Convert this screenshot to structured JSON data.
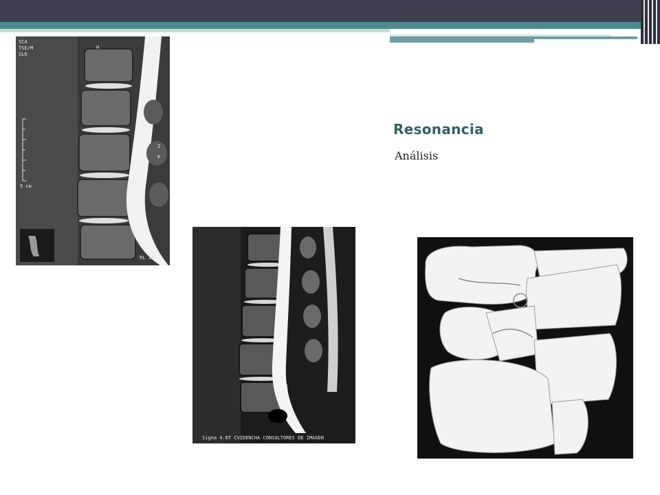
{
  "slide": {
    "title": "Resonancia",
    "subtitle": "Análisis"
  },
  "images": {
    "mri_sagittal_1": {
      "labels": [
        "SC4",
        "TSE/M",
        "SL6",
        "H",
        "I",
        "P",
        "5 cm",
        "RL 14"
      ]
    },
    "mri_sagittal_2": {
      "footer_text": "Signa 4.6T CVIDENCHA CONSULTORES DE IMAGEN"
    },
    "spine_3d_render": {}
  },
  "colors": {
    "header_dark": "#3f3f4f",
    "teal": "#4e8a8f",
    "title_color": "#2f5f67"
  }
}
